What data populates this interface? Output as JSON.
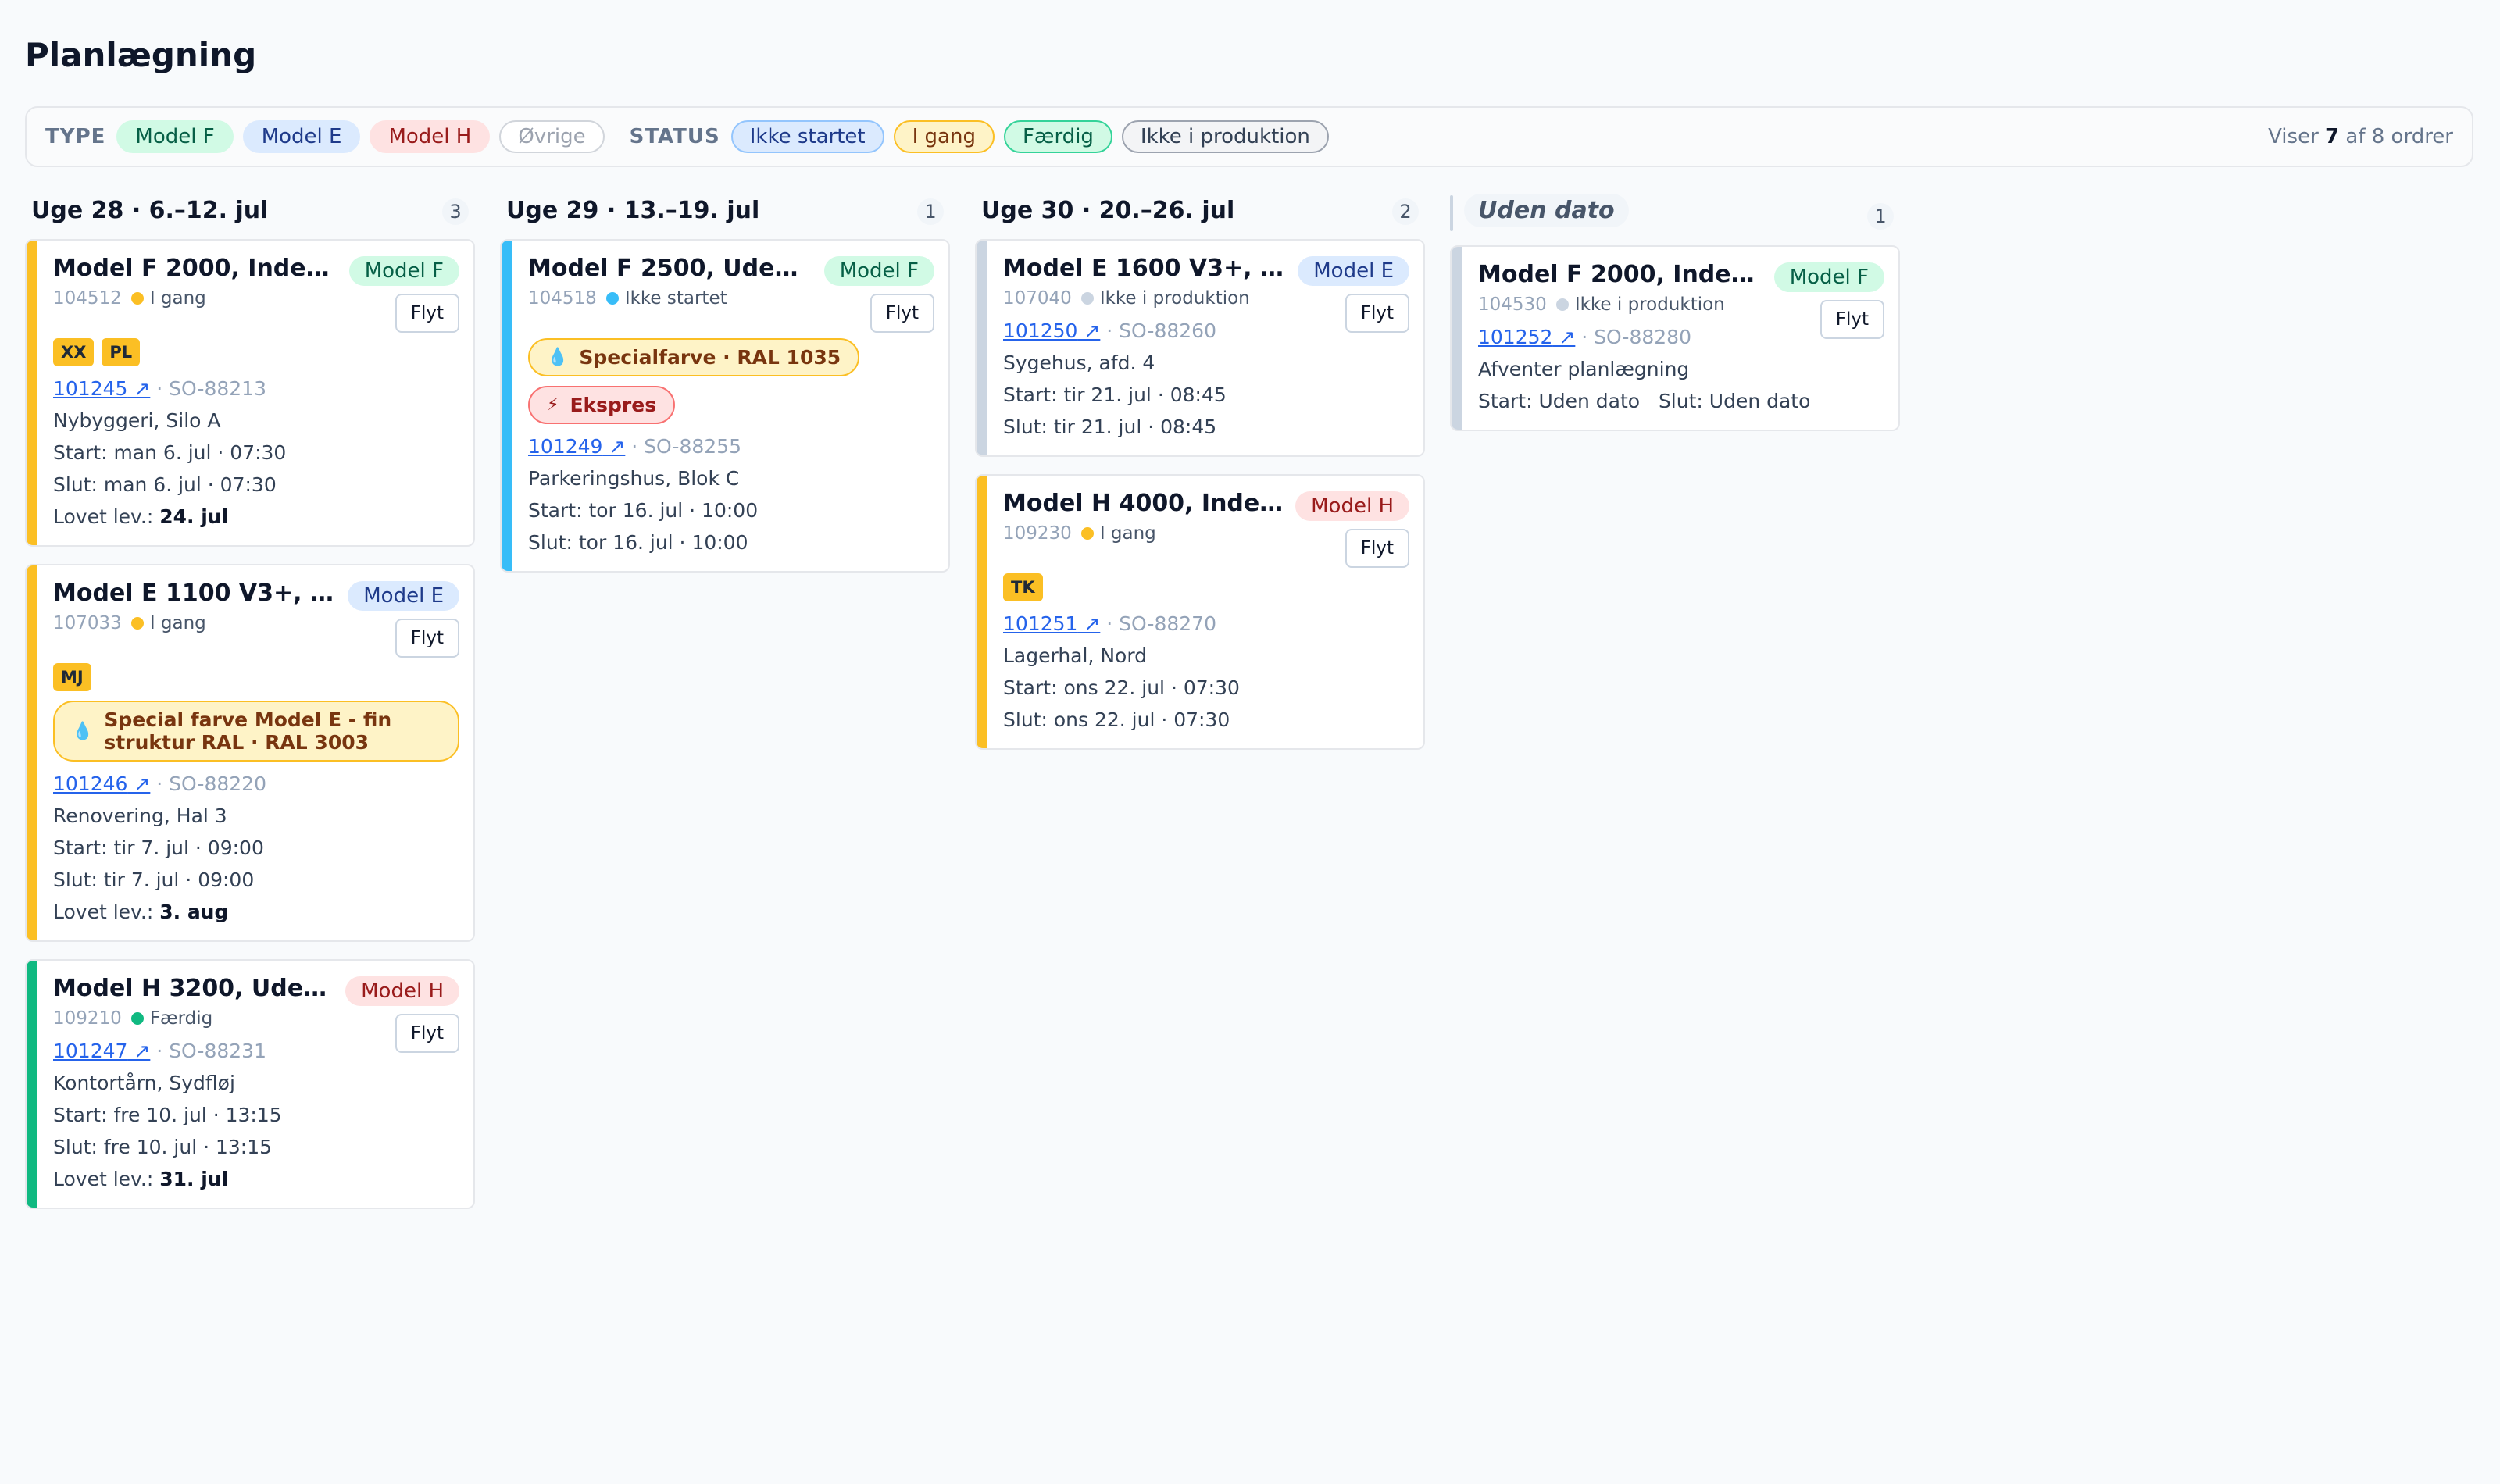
{
  "page": {
    "title": "Planlægning"
  },
  "filters": {
    "type_label": "TYPE",
    "types": [
      "Model F",
      "Model E",
      "Model H",
      "Øvrige"
    ],
    "status_label": "STATUS",
    "statuses": [
      "Ikke startet",
      "I gang",
      "Færdig",
      "Ikke i produktion"
    ],
    "count": {
      "prefix": "Viser",
      "shown": "7",
      "middle": "af 8 ordrer"
    }
  },
  "colors": {
    "model_f": "#d1fae5",
    "model_e": "#dbeafe",
    "model_h": "#fee2e2",
    "status_in_progress": "#fbbf24",
    "status_not_started": "#38bdf8",
    "status_done": "#10b981",
    "status_not_in_production": "#cbd5e1"
  },
  "labels": {
    "move": "Flyt",
    "start": "Start:",
    "end": "Slut:",
    "promised": "Lovet lev.:",
    "ext_link": "↗"
  },
  "columns": [
    {
      "title": "Uge 28 · 6.–12. jul",
      "count": "3",
      "cards": [
        {
          "title": "Model F 2000, Inden…",
          "badge": "Model F",
          "order": "104512",
          "status": "I gang",
          "tags": [
            "XX",
            "PL"
          ],
          "order_ref": "101245",
          "so": "SO-88213",
          "location": "Nybyggeri, Silo A",
          "start": "man 6. jul · 07:30",
          "end": "man 6. jul · 07:30",
          "promised": "24. jul"
        },
        {
          "title": "Model E 1100 V3+, In…",
          "badge": "Model E",
          "order": "107033",
          "status": "I gang",
          "tags": [
            "MJ"
          ],
          "notice": "Special farve Model E - fin struktur RAL · RAL 3003",
          "order_ref": "101246",
          "so": "SO-88220",
          "location": "Renovering, Hal 3",
          "start": "tir 7. jul · 09:00",
          "end": "tir 7. jul · 09:00",
          "promised": "3. aug"
        },
        {
          "title": "Model H 3200, Uden…",
          "badge": "Model H",
          "order": "109210",
          "status": "Færdig",
          "order_ref": "101247",
          "so": "SO-88231",
          "location": "Kontortårn, Sydfløj",
          "start": "fre 10. jul · 13:15",
          "end": "fre 10. jul · 13:15",
          "promised": "31. jul"
        }
      ]
    },
    {
      "title": "Uge 29 · 13.–19. jul",
      "count": "1",
      "cards": [
        {
          "title": "Model F 2500, Udend…",
          "badge": "Model F",
          "order": "104518",
          "status": "Ikke startet",
          "paint": "Specialfarve · RAL 1035",
          "express": "Ekspres",
          "order_ref": "101249",
          "so": "SO-88255",
          "location": "Parkeringshus, Blok C",
          "start": "tor 16. jul · 10:00",
          "end": "tor 16. jul · 10:00"
        }
      ]
    },
    {
      "title": "Uge 30 · 20.–26. jul",
      "count": "2",
      "cards": [
        {
          "title": "Model E 1600 V3+, In…",
          "badge": "Model E",
          "order": "107040",
          "status": "Ikke i produktion",
          "order_ref": "101250",
          "so": "SO-88260",
          "location": "Sygehus, afd. 4",
          "start": "tir 21. jul · 08:45",
          "end": "tir 21. jul · 08:45"
        },
        {
          "title": "Model H 4000, Inden…",
          "badge": "Model H",
          "order": "109230",
          "status": "I gang",
          "tags": [
            "TK"
          ],
          "order_ref": "101251",
          "so": "SO-88270",
          "location": "Lagerhal, Nord",
          "start": "ons 22. jul · 07:30",
          "end": "ons 22. jul · 07:30"
        }
      ]
    },
    {
      "title": "Uden dato",
      "count": "1",
      "cards": [
        {
          "title": "Model F 2000, Inden…",
          "badge": "Model F",
          "order": "104530",
          "status": "Ikke i produktion",
          "order_ref": "101252",
          "so": "SO-88280",
          "location": "Afventer planlægning",
          "start": "Uden dato",
          "end": "Uden dato"
        }
      ]
    }
  ]
}
